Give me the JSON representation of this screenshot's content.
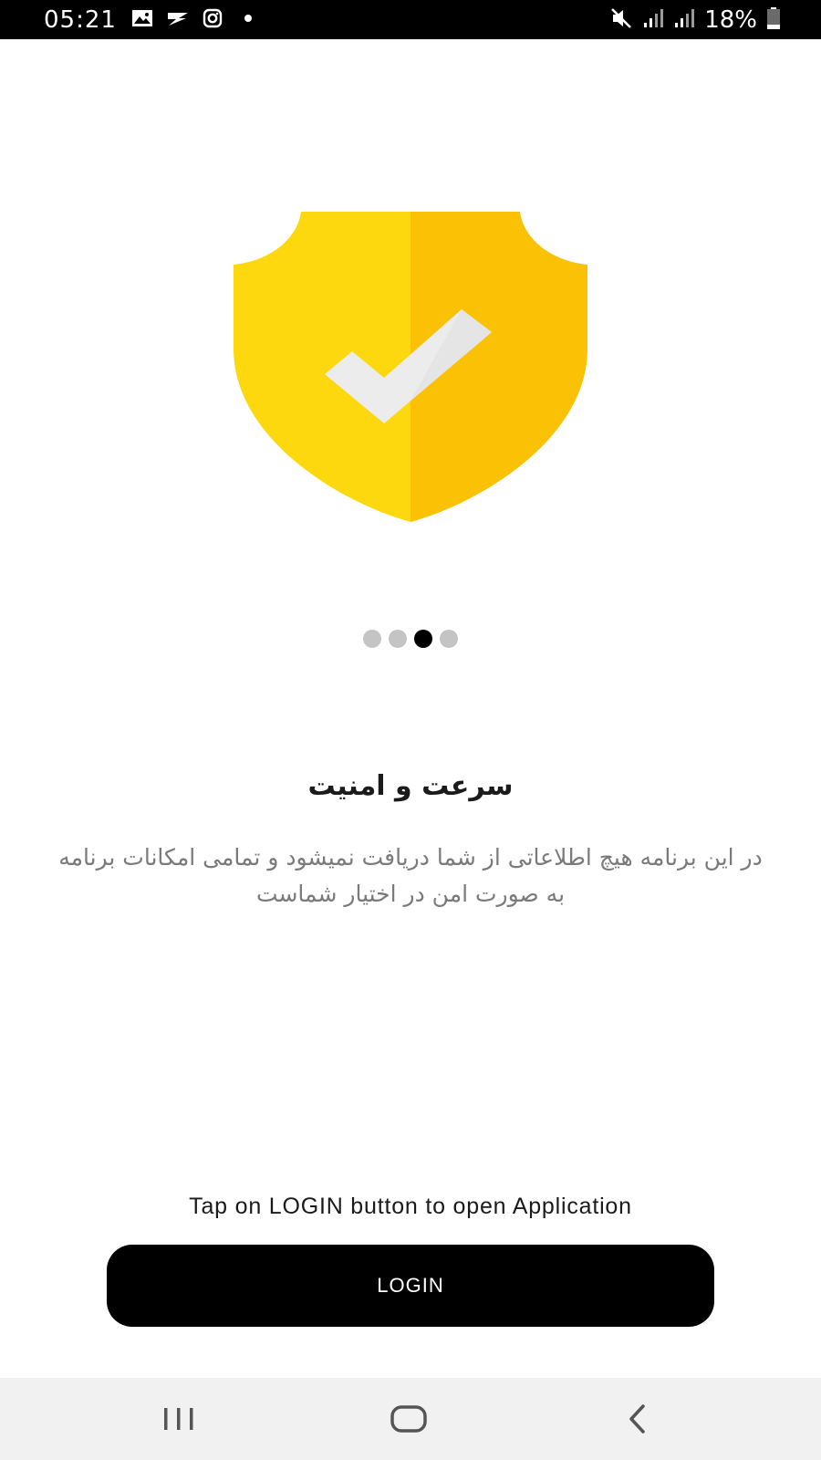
{
  "status_bar": {
    "time": "05:21",
    "battery_percent": "18%",
    "notification_icons": [
      "gallery-icon",
      "flash-icon",
      "instagram-icon",
      "dot-icon"
    ],
    "system_icons": [
      "mute-icon",
      "signal-icon",
      "signal-icon",
      "battery-icon"
    ]
  },
  "onboarding": {
    "page_count": 4,
    "active_page_index": 2,
    "title": "سرعت و امنیت",
    "description": "در این برنامه هیچ اطلاعاتی از شما دریافت نمیشود و تمامی امکانات برنامه به صورت امن در اختیار شماست",
    "illustration": "shield-check-icon"
  },
  "footer": {
    "hint": "Tap on LOGIN button to open Application",
    "login_label": "LOGIN"
  },
  "nav_bar": {
    "buttons": [
      "recent-apps-icon",
      "home-icon",
      "back-icon"
    ]
  },
  "colors": {
    "shield_left": "#FDD80E",
    "shield_right": "#FBC104",
    "check_mark": "#ECECEC",
    "button_bg": "#000000",
    "dot_active": "#000000",
    "dot_inactive": "#C4C4C4"
  }
}
